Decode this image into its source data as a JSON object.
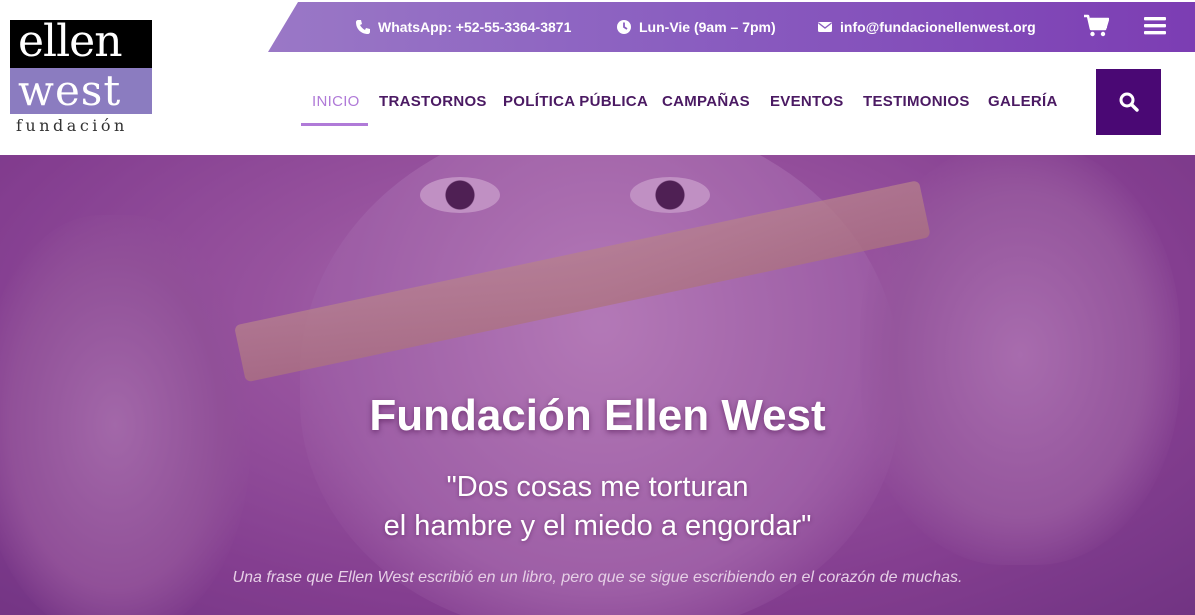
{
  "logo": {
    "line1": "ellen",
    "line2": "west",
    "line3": "fundación"
  },
  "topbar": {
    "whatsapp": "WhatsApp: +52-55-3364-3871",
    "hours": "Lun-Vie (9am – 7pm)",
    "email": "info@fundacionellenwest.org",
    "cart_icon": "cart-icon",
    "menu_icon": "hamburger-icon"
  },
  "nav": {
    "items": [
      {
        "label": "INICIO",
        "active": true
      },
      {
        "label": "TRASTORNOS"
      },
      {
        "label": "POLÍTICA PÚBLICA"
      },
      {
        "label": "CAMPAÑAS"
      },
      {
        "label": "EVENTOS"
      },
      {
        "label": "TESTIMONIOS"
      },
      {
        "label": "GALERÍA"
      }
    ],
    "search_icon": "search-icon"
  },
  "hero": {
    "title": "Fundación Ellen West",
    "quote_line1": "\"Dos cosas me torturan",
    "quote_line2": "el hambre y el miedo a engordar\"",
    "subtitle": "Una frase que Ellen West escribió en un libro, pero que se sigue escribiendo en el corazón de muchas."
  },
  "colors": {
    "primary": "#4a0874",
    "accent": "#b07ad8",
    "nav_text": "#4b1a63"
  }
}
